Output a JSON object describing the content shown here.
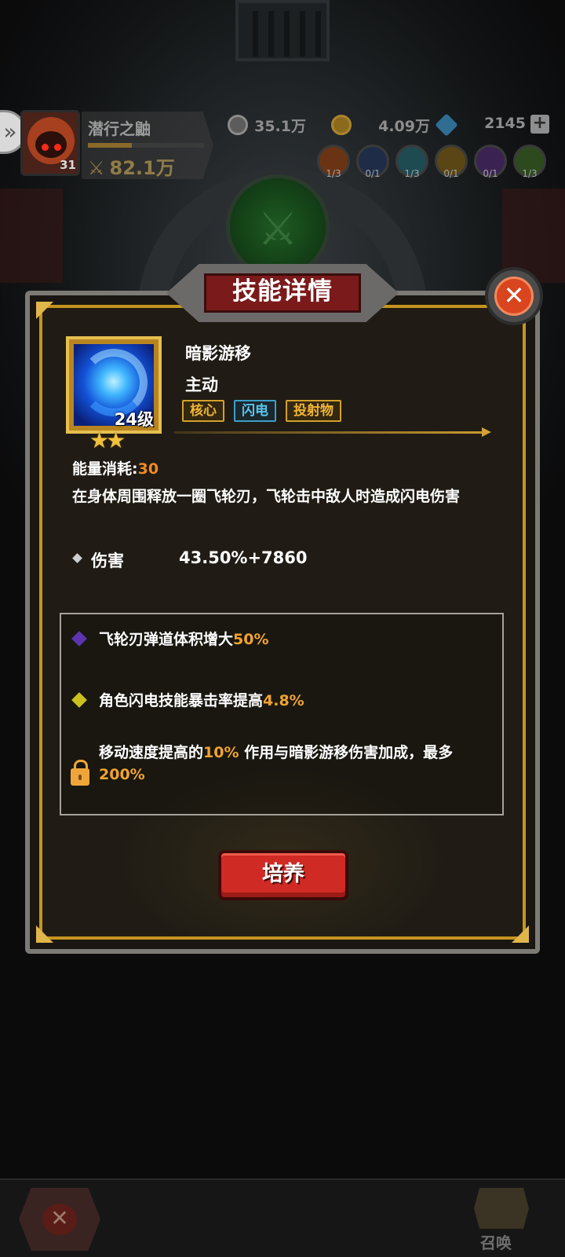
{
  "player": {
    "name": "潜行之鼬",
    "level": "31",
    "power": "82.1万"
  },
  "resources": [
    {
      "icon": "soul-orb-icon",
      "value": "35.1万"
    },
    {
      "icon": "gold-coin-icon",
      "value": "4.09万"
    },
    {
      "icon": "diamond-icon",
      "value": "2145"
    }
  ],
  "elements": [
    {
      "icon": "fire-element-icon",
      "count": "1/3",
      "color": "#6a3414"
    },
    {
      "icon": "dark-element-icon",
      "count": "0/1",
      "color": "#1f2c47"
    },
    {
      "icon": "ice-element-icon",
      "count": "1/3",
      "color": "#1e4a52"
    },
    {
      "icon": "gold-element-icon",
      "count": "0/1",
      "color": "#5a4614"
    },
    {
      "icon": "shadow-element-icon",
      "count": "0/1",
      "color": "#3a2352"
    },
    {
      "icon": "nature-element-icon",
      "count": "1/3",
      "color": "#2d4a1f"
    }
  ],
  "dialog": {
    "title": "技能详情",
    "skill": {
      "name": "暗影游移",
      "type": "主动",
      "level_label": "24级",
      "stars": 2,
      "tags": [
        {
          "label": "核心",
          "style": "gold"
        },
        {
          "label": "闪电",
          "style": "blue"
        },
        {
          "label": "投射物",
          "style": "gold"
        }
      ],
      "energy_label": "能量消耗:",
      "energy_value": "30",
      "description": "在身体周围释放一圈飞轮刃，飞轮击中敌人时造成闪电伤害",
      "damage_label": "伤害",
      "damage_value": "43.50%+7860"
    },
    "passives": [
      {
        "icon": "purple-diamond-icon",
        "color": "#5b35b0",
        "text": "飞轮刃弹道体积增大",
        "highlight": "50%",
        "tail": "",
        "locked": false
      },
      {
        "icon": "yellow-diamond-icon",
        "color": "#c9c21e",
        "text": "角色闪电技能暴击率提高",
        "highlight": "4.8%",
        "tail": "",
        "locked": false
      },
      {
        "icon": "lock-icon",
        "color": "#f0a53a",
        "text": "移动速度提高的",
        "highlight": "10%",
        "tail": " 作用与暗影游移伤害加成，最多",
        "highlight2": "200%",
        "locked": true
      }
    ],
    "cultivate_label": "培养"
  },
  "bottom_nav": {
    "summon_label": "召唤"
  }
}
